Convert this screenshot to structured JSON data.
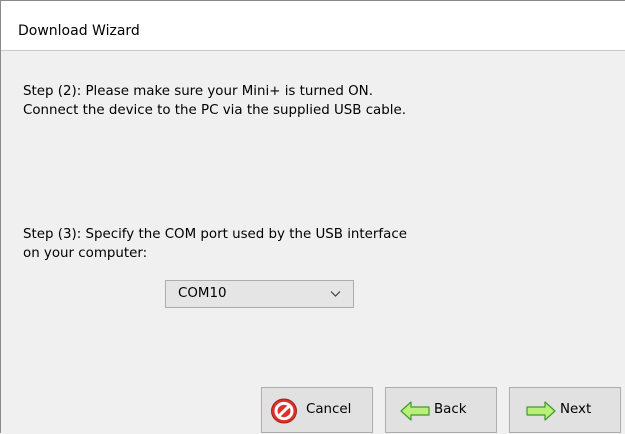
{
  "window": {
    "title": "Download Wizard"
  },
  "steps": {
    "step2_text": "Step (2): Please make sure your Mini+ is turned ON. Connect the device to the PC via the supplied USB cable.",
    "step3_text": "Step (3): Specify the COM port used by the USB interface on your computer:"
  },
  "com_port": {
    "selected": "COM10"
  },
  "buttons": {
    "cancel_label": "Cancel",
    "back_label": "Back",
    "next_label": "Next"
  },
  "icons": {
    "cancel": "cancel-icon",
    "back": "back-arrow-icon",
    "next": "next-arrow-icon",
    "dropdown": "chevron-down-icon"
  },
  "colors": {
    "cancel_icon_red": "#d9332b",
    "arrow_green_fill": "#b9f07a",
    "arrow_green_stroke": "#3f9a2a"
  }
}
